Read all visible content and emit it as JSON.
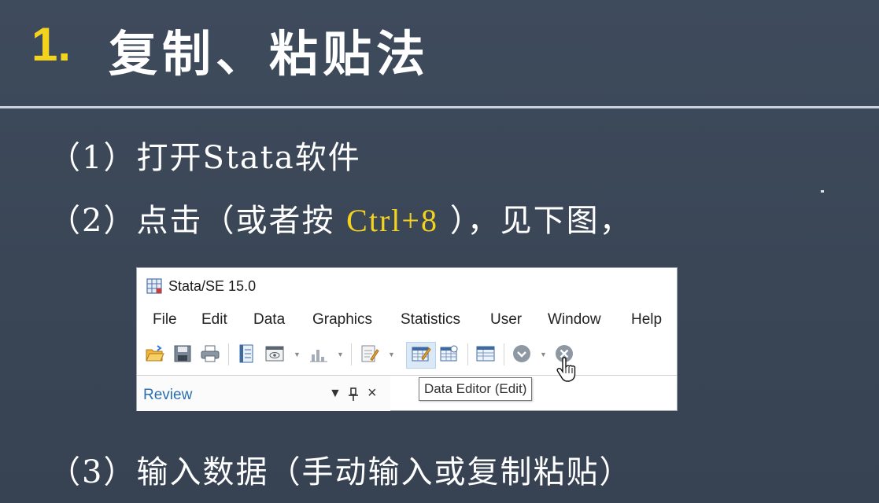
{
  "slide": {
    "title_number": "1.",
    "title_text": "复制、粘贴法",
    "step1": "（1）打开Stata软件",
    "step2_prefix": "（2）点击（或者按",
    "step2_shortcut": "Ctrl+8",
    "step2_suffix": "），见下图，",
    "step3": "（3）输入数据（手动输入或复制粘贴）"
  },
  "stata_window": {
    "title": "Stata/SE 15.0",
    "menu": [
      "File",
      "Edit",
      "Data",
      "Graphics",
      "Statistics",
      "User",
      "Window",
      "Help"
    ],
    "toolbar_icons": [
      "open-icon",
      "save-icon",
      "print-icon",
      "log-icon",
      "viewer-icon",
      "graph-icon",
      "do-file-editor-icon",
      "data-editor-edit-icon",
      "data-editor-browse-icon",
      "variables-manager-icon",
      "more-icon",
      "break-icon"
    ],
    "review_label": "Review",
    "tooltip": "Data Editor (Edit)"
  },
  "colors": {
    "background": "#3b4757",
    "highlight": "#f3d31d",
    "text": "#ffffff",
    "review_label": "#2b6fb3"
  }
}
